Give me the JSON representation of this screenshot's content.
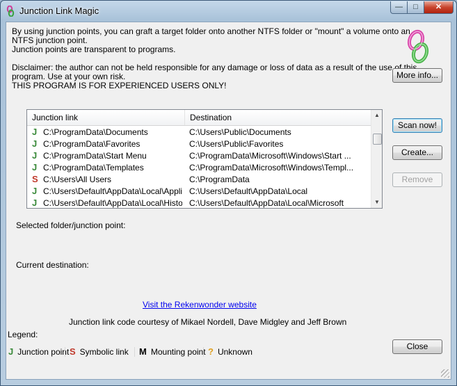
{
  "window": {
    "title": "Junction Link Magic"
  },
  "intro": {
    "line1": "By using junction points, you can graft a target folder onto another NTFS folder or \"mount\" a volume onto an",
    "line2": "NTFS junction point.",
    "line3": "Junction points are transparent to programs.",
    "disclaimer1": "Disclaimer: the author can not be held responsible for any damage or loss of data as a result of the use of this",
    "disclaimer2": "program. Use at your own risk.",
    "warning": "THIS PROGRAM IS FOR EXPERIENCED USERS ONLY!"
  },
  "buttons": {
    "more_info": "More info...",
    "scan_now": "Scan now!",
    "create": "Create...",
    "remove": "Remove",
    "close": "Close"
  },
  "list": {
    "columns": [
      "Junction link",
      "Destination"
    ],
    "rows": [
      {
        "type": "J",
        "link": "C:\\ProgramData\\Documents",
        "dest": "C:\\Users\\Public\\Documents"
      },
      {
        "type": "J",
        "link": "C:\\ProgramData\\Favorites",
        "dest": "C:\\Users\\Public\\Favorites"
      },
      {
        "type": "J",
        "link": "C:\\ProgramData\\Start Menu",
        "dest": "C:\\ProgramData\\Microsoft\\Windows\\Start ..."
      },
      {
        "type": "J",
        "link": "C:\\ProgramData\\Templates",
        "dest": "C:\\ProgramData\\Microsoft\\Windows\\Templ..."
      },
      {
        "type": "S",
        "link": "C:\\Users\\All Users",
        "dest": "C:\\ProgramData"
      },
      {
        "type": "J",
        "link": "C:\\Users\\Default\\AppData\\Local\\Appli...",
        "dest": "C:\\Users\\Default\\AppData\\Local"
      },
      {
        "type": "J",
        "link": "C:\\Users\\Default\\AppData\\Local\\History",
        "dest": "C:\\Users\\Default\\AppData\\Local\\Microsoft"
      }
    ]
  },
  "fields": {
    "selected_label": "Selected folder/junction point:",
    "current_dest_label": "Current destination:"
  },
  "website_link": "Visit the Rekenwonder website",
  "credits": "Junction link code courtesy of Mikael Nordell, Dave Midgley and Jeff Brown",
  "legend": {
    "title": "Legend:",
    "items": [
      {
        "glyph": "J",
        "label": "Junction point",
        "color": "#3a8a3a"
      },
      {
        "glyph": "S",
        "label": "Symbolic link",
        "color": "#c0392b"
      },
      {
        "glyph": "M",
        "label": "Mounting point",
        "color": "#000000"
      },
      {
        "glyph": "?",
        "label": "Unknown",
        "color": "#e0a020"
      }
    ]
  },
  "colors": {
    "junction": "#3a8a3a",
    "symbolic": "#c0392b"
  },
  "icons": {
    "app": "chain-link-icon",
    "window_controls": [
      "minimize-icon",
      "maximize-icon",
      "close-icon"
    ]
  }
}
